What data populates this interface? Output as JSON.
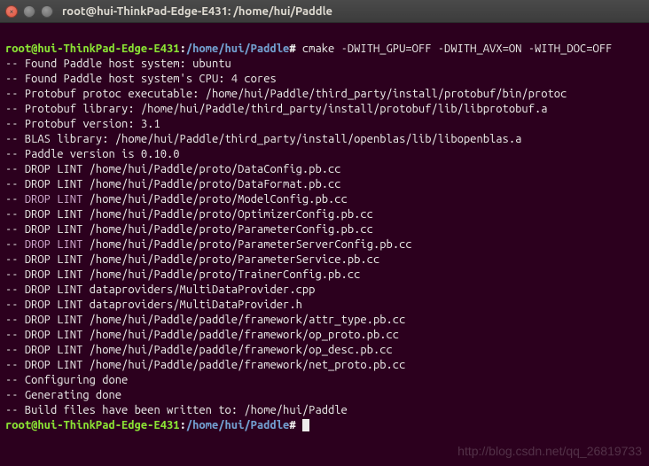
{
  "window": {
    "title": "root@hui-ThinkPad-Edge-E431: /home/hui/Paddle"
  },
  "prompt": {
    "user_host": "root@hui-ThinkPad-Edge-E431",
    "sep1": ":",
    "path": "/home/hui/Paddle",
    "sep2": "#"
  },
  "command": "cmake -DWITH_GPU=OFF -DWITH_AVX=ON -WITH_DOC=OFF",
  "output_lines": [
    "-- Found Paddle host system: ubuntu",
    "-- Found Paddle host system's CPU: 4 cores",
    "-- Protobuf protoc executable: /home/hui/Paddle/third_party/install/protobuf/bin/protoc",
    "-- Protobuf library: /home/hui/Paddle/third_party/install/protobuf/lib/libprotobuf.a",
    "-- Protobuf version: 3.1",
    "-- BLAS library: /home/hui/Paddle/third_party/install/openblas/lib/libopenblas.a",
    "-- Paddle version is 0.10.0",
    "-- DROP LINT /home/hui/Paddle/proto/DataConfig.pb.cc",
    "-- DROP LINT /home/hui/Paddle/proto/DataFormat.pb.cc",
    "-- DROP LINT /home/hui/Paddle/proto/ModelConfig.pb.cc",
    "-- DROP LINT /home/hui/Paddle/proto/OptimizerConfig.pb.cc",
    "-- DROP LINT /home/hui/Paddle/proto/ParameterConfig.pb.cc",
    "-- DROP LINT /home/hui/Paddle/proto/ParameterServerConfig.pb.cc",
    "-- DROP LINT /home/hui/Paddle/proto/ParameterService.pb.cc",
    "-- DROP LINT /home/hui/Paddle/proto/TrainerConfig.pb.cc",
    "-- DROP LINT dataproviders/MultiDataProvider.cpp",
    "-- DROP LINT dataproviders/MultiDataProvider.h",
    "-- DROP LINT /home/hui/Paddle/paddle/framework/attr_type.pb.cc",
    "-- DROP LINT /home/hui/Paddle/paddle/framework/op_proto.pb.cc",
    "-- DROP LINT /home/hui/Paddle/paddle/framework/op_desc.pb.cc",
    "-- DROP LINT /home/hui/Paddle/paddle/framework/net_proto.pb.cc",
    "-- Configuring done",
    "-- Generating done",
    "-- Build files have been written to: /home/hui/Paddle"
  ],
  "lint_highlight_indices": [
    9,
    12
  ],
  "watermark": "http://blog.csdn.net/qq_26819733"
}
